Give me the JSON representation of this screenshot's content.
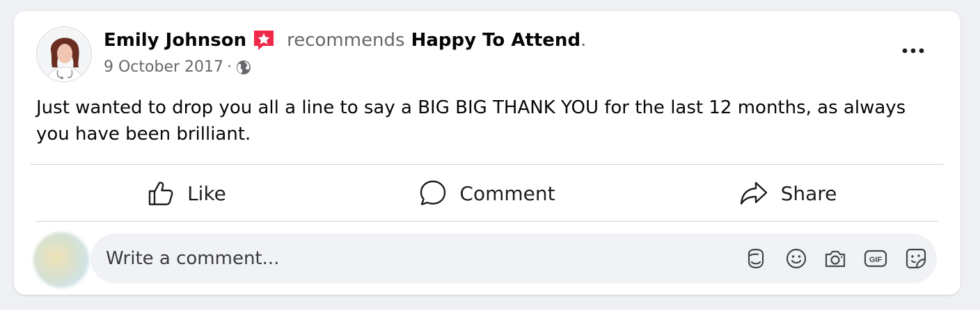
{
  "post": {
    "author_name": "Emily Johnson",
    "verb": "recommends",
    "page_name": "Happy To Attend",
    "header_end": ".",
    "date": "9 October 2017",
    "meta_separator": "·",
    "audience_icon": "globe-icon",
    "body": "Just wanted to drop you all a line to say a BIG BIG THANK YOU for the last 12 months, as always you have been brilliant."
  },
  "actions": {
    "like_label": "Like",
    "comment_label": "Comment",
    "share_label": "Share"
  },
  "comment_box": {
    "placeholder": "Write a comment...",
    "icons": [
      "avatar-sticker-icon",
      "emoji-icon",
      "camera-icon",
      "gif-icon",
      "sticker-icon"
    ]
  },
  "colors": {
    "recommend_badge": "#f02849",
    "secondary_text": "#65676b",
    "divider": "#ced0d4",
    "comment_bg": "#f0f2f5",
    "page_bg": "#eef0f3"
  }
}
